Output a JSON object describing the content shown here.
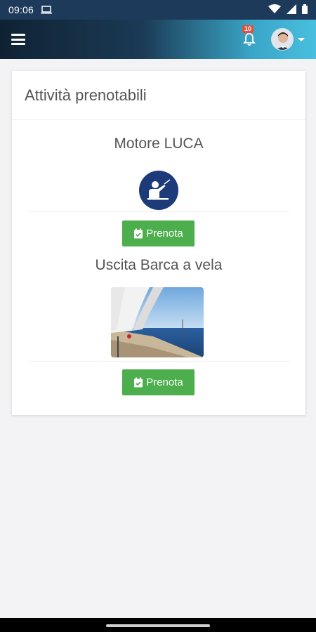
{
  "status_bar": {
    "time": "09:06"
  },
  "header": {
    "notification_count": "10"
  },
  "card": {
    "title": "Attività prenotabili",
    "activities": [
      {
        "name": "Motore LUCA",
        "icon": "teacher-icon",
        "button_label": "Prenota"
      },
      {
        "name": "Uscita Barca a vela",
        "image": "sailboat-photo",
        "button_label": "Prenota"
      }
    ]
  },
  "colors": {
    "button": "#4cae4c",
    "icon_bg": "#1d3b78",
    "badge": "#e74c3c"
  }
}
